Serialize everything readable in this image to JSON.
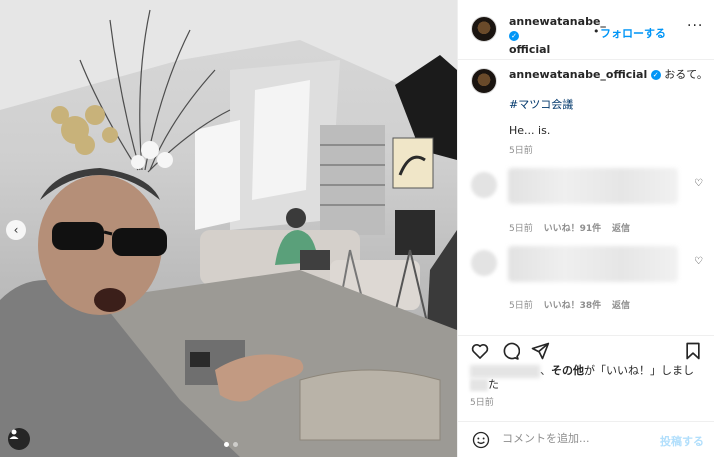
{
  "post": {
    "username_line1": "annewatanabe_",
    "username_line2": "official",
    "follow_label": "フォローする",
    "more_label": "···",
    "verified_mark": "✓"
  },
  "caption": {
    "username": "annewatanabe_official",
    "verified_mark": "✓",
    "text": "おるて。",
    "hashtag": "#マツコ会議",
    "body": "He... is.",
    "time": "5日前"
  },
  "comments": [
    {
      "time": "5日前",
      "likes": "いいね！91件",
      "reply": "返信"
    },
    {
      "time": "5日前",
      "likes": "いいね！38件",
      "reply": "返信"
    }
  ],
  "likes_line": {
    "prefix": "、",
    "middle": "その他",
    "suffix": "が「いいね！」しまし",
    "wrap": "た"
  },
  "post_time": "5日前",
  "add_comment": {
    "placeholder": "コメントを追加...",
    "post_label": "投稿する"
  },
  "icons": {
    "nav_prev": "‹"
  }
}
